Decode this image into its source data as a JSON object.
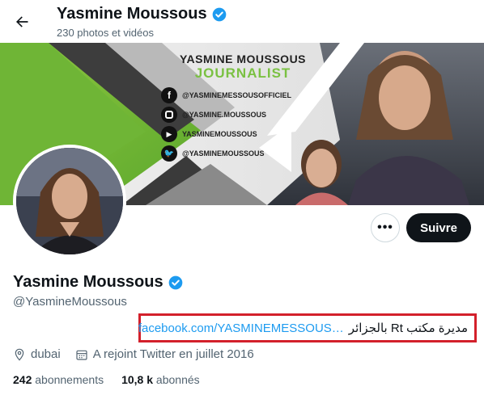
{
  "header": {
    "title": "Yasmine Moussous",
    "subtitle": "230 photos et vidéos",
    "back_icon": "arrow-left-icon"
  },
  "banner": {
    "heading": "YASMINE MOUSSOUS",
    "role": "JOURNALIST",
    "socials": [
      {
        "icon": "facebook-icon",
        "handle": "@YASMINEMESSOUSOFFICIEL"
      },
      {
        "icon": "instagram-icon",
        "handle": "@YASMINE.MOUSSOUS"
      },
      {
        "icon": "youtube-icon",
        "handle": "YASMINEMOUSSOUS"
      },
      {
        "icon": "twitter-icon",
        "handle": "@YASMINEMOUSSOUS"
      }
    ]
  },
  "actions": {
    "more": "•••",
    "follow": "Suivre"
  },
  "profile": {
    "name": "Yasmine Moussous",
    "handle": "@YasmineMoussous",
    "verified_icon": "verified-badge-icon",
    "bio_text": "مديرة مكتب  Rt  بالجزائر",
    "bio_link": "facebook.com/YASMINEMESSOUS…",
    "location": "dubai",
    "joined": "A rejoint Twitter en juillet 2016"
  },
  "stats": {
    "following_count": "242",
    "following_label": "abonnements",
    "followers_count": "10,8 k",
    "followers_label": "abonnés"
  },
  "colors": {
    "accent": "#1d9bf0",
    "highlight_border": "#d3202b",
    "banner_green": "#7ac142"
  }
}
